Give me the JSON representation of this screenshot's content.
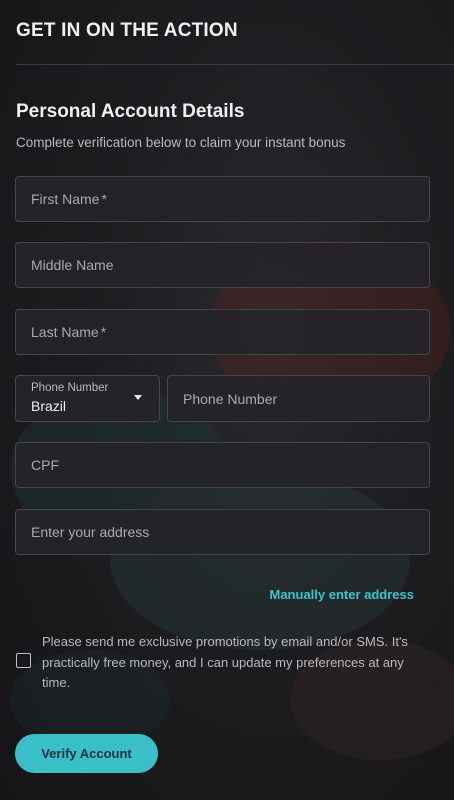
{
  "header": {
    "title": "GET IN ON THE ACTION"
  },
  "section": {
    "title": "Personal Account Details",
    "subtitle": "Complete verification below to claim your instant bonus"
  },
  "fields": {
    "first_name": {
      "placeholder": "First Name",
      "required_mark": "*"
    },
    "middle_name": {
      "placeholder": "Middle Name"
    },
    "last_name": {
      "placeholder": "Last Name",
      "required_mark": "*"
    },
    "phone_country": {
      "label": "Phone Number",
      "value": "Brazil"
    },
    "phone_number": {
      "placeholder": "Phone Number"
    },
    "cpf": {
      "placeholder": "CPF"
    },
    "address": {
      "placeholder": "Enter your address"
    }
  },
  "links": {
    "manual_address": "Manually enter address"
  },
  "consent": {
    "checked": false,
    "text": "Please send me exclusive promotions by email and/or SMS. It's practically free money, and I can update my preferences at any time."
  },
  "actions": {
    "verify_label": "Verify Account"
  },
  "colors": {
    "accent": "#38bfc8",
    "link": "#35c6cf",
    "field_bg": "#242428",
    "field_border": "#45454b"
  }
}
